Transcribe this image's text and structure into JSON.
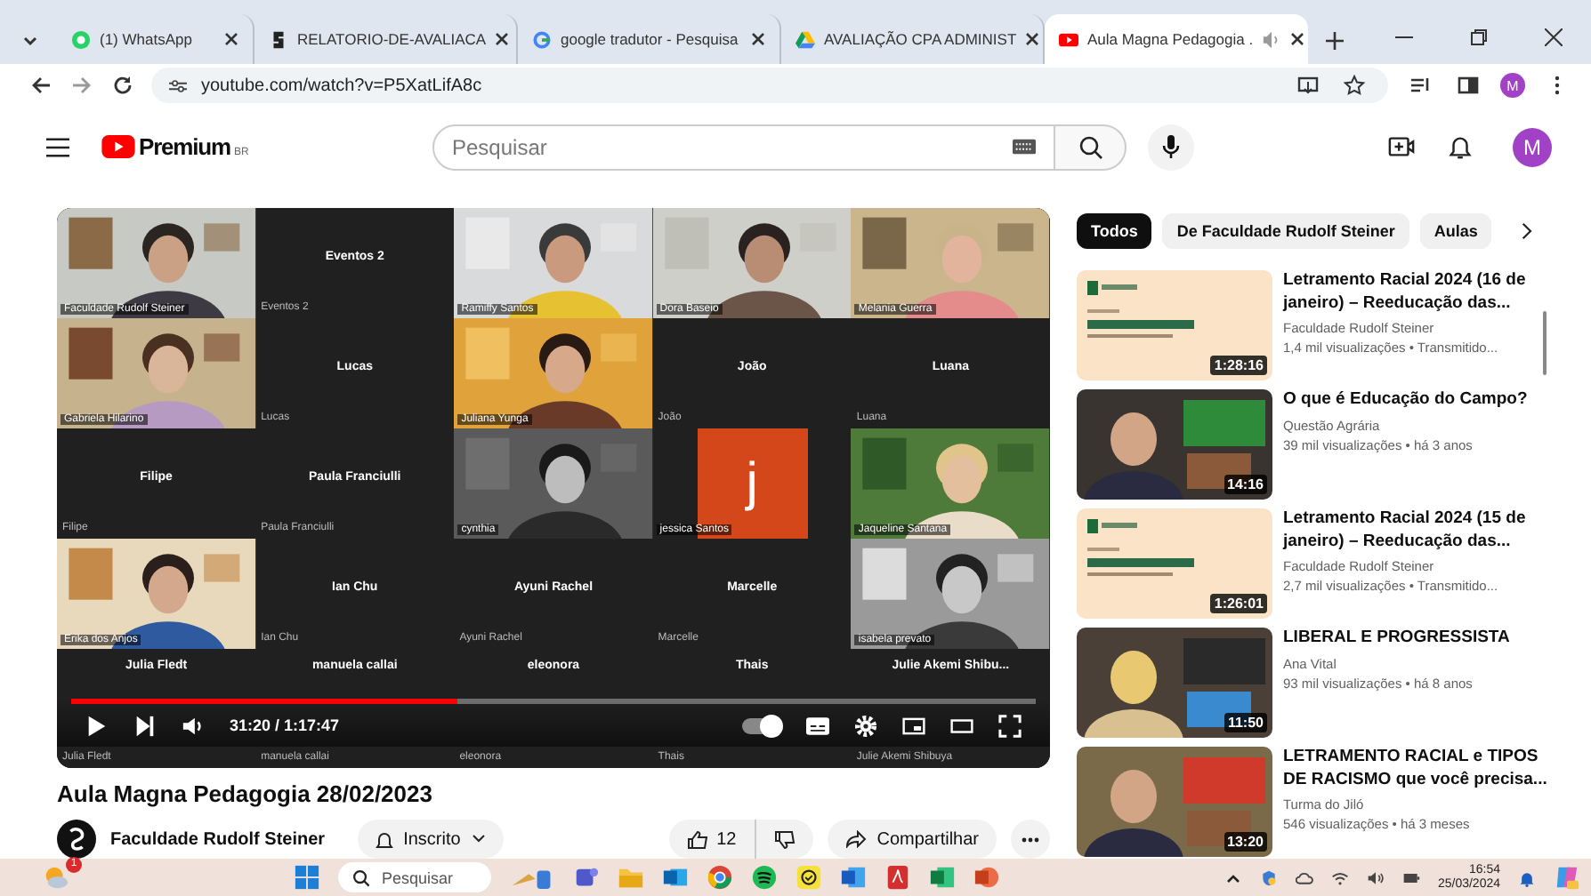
{
  "browser": {
    "tabs": [
      {
        "title": "(1) WhatsApp",
        "kind": "chat",
        "selected": false
      },
      {
        "title": "RELATORIO-DE-AVALIACA",
        "kind": "document",
        "selected": false
      },
      {
        "title": "google tradutor - Pesquisa",
        "kind": "search",
        "selected": false
      },
      {
        "title": "AVALIAÇÃO CPA ADMINIST",
        "kind": "drive",
        "selected": false
      },
      {
        "title": "Aula Magna Pedagogia .",
        "kind": "video",
        "selected": true
      }
    ],
    "url": "youtube.com/watch?v=P5XatLifA8c",
    "profile": "M"
  },
  "header": {
    "logo": "Premium",
    "region": "BR",
    "search_placeholder": "Pesquisar",
    "avatar": "M"
  },
  "video": {
    "tiles": [
      {
        "kind": "video",
        "name": "Faculdade Rudolf Steiner"
      },
      {
        "kind": "blank",
        "heading": "Eventos 2",
        "name": "Eventos 2"
      },
      {
        "kind": "video",
        "name": "Ramiffy Santos"
      },
      {
        "kind": "video",
        "name": "Dora Baseio"
      },
      {
        "kind": "video",
        "name": "Melania Guerra"
      },
      {
        "kind": "video",
        "name": "Gabriela Hilarino"
      },
      {
        "kind": "blank",
        "heading": "Lucas",
        "name": "Lucas"
      },
      {
        "kind": "video",
        "name": "Juliana Yunga"
      },
      {
        "kind": "blank",
        "heading": "João",
        "name": "João"
      },
      {
        "kind": "blank",
        "heading": "Luana",
        "name": "Luana"
      },
      {
        "kind": "blank",
        "heading": "Filipe",
        "name": "Filipe"
      },
      {
        "kind": "blank",
        "heading": "Paula Franciulli",
        "name": "Paula Franciulli"
      },
      {
        "kind": "video",
        "name": "cynthia"
      },
      {
        "kind": "initial",
        "initial": "j",
        "name": "jessica Santos"
      },
      {
        "kind": "video",
        "name": "Jaqueline Santana"
      },
      {
        "kind": "video",
        "name": "Erika dos Anjos"
      },
      {
        "kind": "blank",
        "heading": "Ian Chu",
        "name": "Ian Chu"
      },
      {
        "kind": "blank",
        "heading": "Ayuni Rachel",
        "name": "Ayuni Rachel"
      },
      {
        "kind": "blank",
        "heading": "Marcelle",
        "name": "Marcelle"
      },
      {
        "kind": "video",
        "name": "isabela prevato"
      },
      {
        "kind": "blank",
        "heading": "Julia Fledt",
        "name": "Julia Fledt"
      },
      {
        "kind": "blank",
        "heading": "manuela callai",
        "name": "manuela callai"
      },
      {
        "kind": "blank",
        "heading": "eleonora",
        "name": "eleonora"
      },
      {
        "kind": "blank",
        "heading": "Thais",
        "name": "Thais"
      },
      {
        "kind": "blank",
        "heading": "Julie Akemi Shibu...",
        "name": "Julie Akemi Shibuya"
      }
    ],
    "progress": {
      "level": 0.4
    },
    "time": "31:20 / 1:17:47",
    "autoplay": {
      "on": true
    }
  },
  "title": "Aula Magna Pedagogia 28/02/2023",
  "channel": {
    "name": "Faculdade Rudolf Steiner",
    "subscribe": "Inscrito",
    "likes": "12",
    "share": "Compartilhar"
  },
  "sidebar": {
    "chips": [
      {
        "label": "Todos",
        "selected": true
      },
      {
        "label": "De Faculdade Rudolf Steiner",
        "selected": false
      },
      {
        "label": "Aulas",
        "selected": false
      }
    ],
    "videos": [
      {
        "kind": "slide",
        "duration": "1:28:16",
        "title": "Letramento Racial 2024 (16 de janeiro) – Reeducação das...",
        "channel": "Faculdade Rudolf Steiner",
        "meta": "1,4 mil visualizações • Transmitido..."
      },
      {
        "duration": "14:16",
        "title": "O que é Educação do Campo?",
        "channel": "Questão Agrária",
        "meta": "39 mil visualizações • há 3 anos"
      },
      {
        "kind": "slide",
        "duration": "1:26:01",
        "title": "Letramento Racial 2024 (15 de janeiro) – Reeducação das...",
        "channel": "Faculdade Rudolf Steiner",
        "meta": "2,7 mil visualizações • Transmitido..."
      },
      {
        "duration": "11:50",
        "title": "LIBERAL E PROGRESSISTA",
        "channel": "Ana Vital",
        "meta": "93 mil visualizações • há 8 anos"
      },
      {
        "duration": "13:20",
        "title": "LETRAMENTO RACIAL e TIPOS DE RACISMO que você precisa...",
        "channel": "Turma do Jiló",
        "meta": "546 visualizações • há 3 meses"
      }
    ]
  },
  "taskbar": {
    "weather_badge": "1",
    "search_placeholder": "Pesquisar",
    "time": "16:54",
    "date": "25/03/2024"
  }
}
